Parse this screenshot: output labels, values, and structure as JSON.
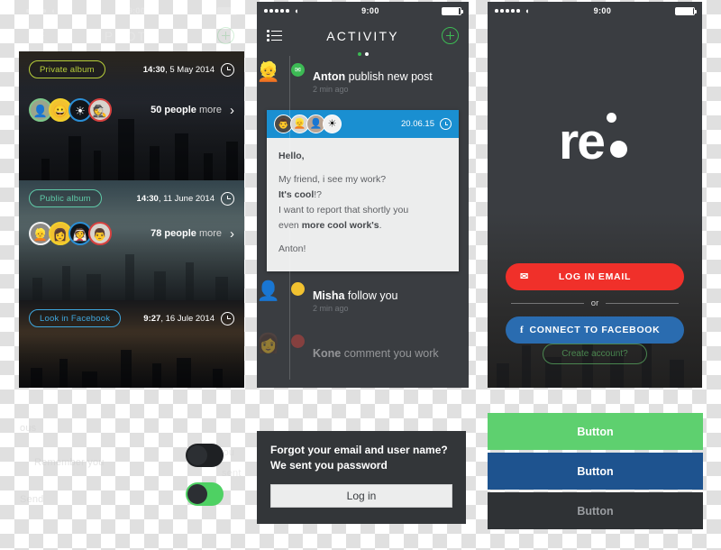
{
  "phone1": {
    "status": {
      "time": "9:00",
      "signal_dots": 4,
      "wifi": "wifi-icon",
      "battery": "battery-icon"
    },
    "nav": {
      "title": "PHOTO",
      "menu_icon": "list-icon",
      "add_icon": "plus-circle-icon"
    },
    "albums": [
      {
        "chip": "Private album",
        "chip_color": "#b8cf3a",
        "time": "14:30",
        "date": ", 5 May 2014",
        "people_count": "50 people",
        "people_more": "more",
        "avatars": [
          "green",
          "yellow",
          "blue",
          "red"
        ]
      },
      {
        "chip": "Public album",
        "chip_color": "#5fc9a8",
        "time": "14:30",
        "date": ", 11 June 2014",
        "people_count": "78 people",
        "people_more": "more",
        "avatars": [
          "white",
          "yellow",
          "blue",
          "red"
        ]
      },
      {
        "chip": "Look in Facebook",
        "chip_color": "#3ea6dd",
        "time": "9:27",
        "date": ", 16 Jule 2014"
      }
    ]
  },
  "phone2": {
    "status": {
      "time": "9:00"
    },
    "nav": {
      "title": "ACTIVITY",
      "menu_icon": "list-icon",
      "add_icon": "plus-circle-icon"
    },
    "pagedots": {
      "active_color": "#3cba54",
      "inactive_color": "#ffffff"
    },
    "feed": [
      {
        "name": "Anton",
        "action": "publish new post",
        "ago": "2 min ago",
        "badge": "mail-icon",
        "badge_color": "#3cba54"
      }
    ],
    "message": {
      "date": "20.06.15",
      "clock_icon": "clock-icon",
      "greeting": "Hello,",
      "line1": "My friend, i see my work?",
      "line2_bold": "It's cool",
      "line2_rest": "!?",
      "line3": "I want to report that shortly you",
      "line4_pre": "even ",
      "line4_bold": "more cool work's",
      "line4_post": ".",
      "signature": "Anton!"
    },
    "feed_more": [
      {
        "name": "Misha",
        "action": "follow you",
        "ago": "2 min ago",
        "badge": "dot-icon",
        "badge_color": "#f2c230"
      },
      {
        "name": "Kone",
        "action": "comment you work",
        "ago": "",
        "badge": "dot-icon",
        "badge_color": "#e0443e"
      }
    ]
  },
  "phone3": {
    "status": {
      "time": "9:00"
    },
    "logo": "re",
    "login_email": {
      "label": "LOG IN EMAIL",
      "icon": "envelope-icon",
      "color": "#f0302a"
    },
    "or": "or",
    "facebook": {
      "label": "CONNECT TO FACEBOOK",
      "icon": "facebook-icon",
      "color": "#2a6cb0"
    },
    "create_account": "Create account?"
  },
  "bottom": {
    "toggle_off": {
      "name": "toggle-off",
      "state": "off"
    },
    "toggle_on": {
      "name": "toggle-on",
      "state": "on",
      "color": "#4ed163"
    },
    "ghost": {
      "g1": "ous",
      "g2": "Remember you",
      "g3": "Send",
      "g4": "send you",
      "g5": "sent"
    },
    "login_box": {
      "line1": "Forgot your email and user name?",
      "line2": "We sent you password",
      "button": "Log in"
    },
    "buttons": [
      {
        "label": "Button",
        "color": "#5ed06f",
        "text_color": "#ffffff"
      },
      {
        "label": "Button",
        "color": "#1e538f",
        "text_color": "#ffffff"
      },
      {
        "label": "Button",
        "color": "#2f3235",
        "text_color": "#9a9da1"
      }
    ]
  }
}
